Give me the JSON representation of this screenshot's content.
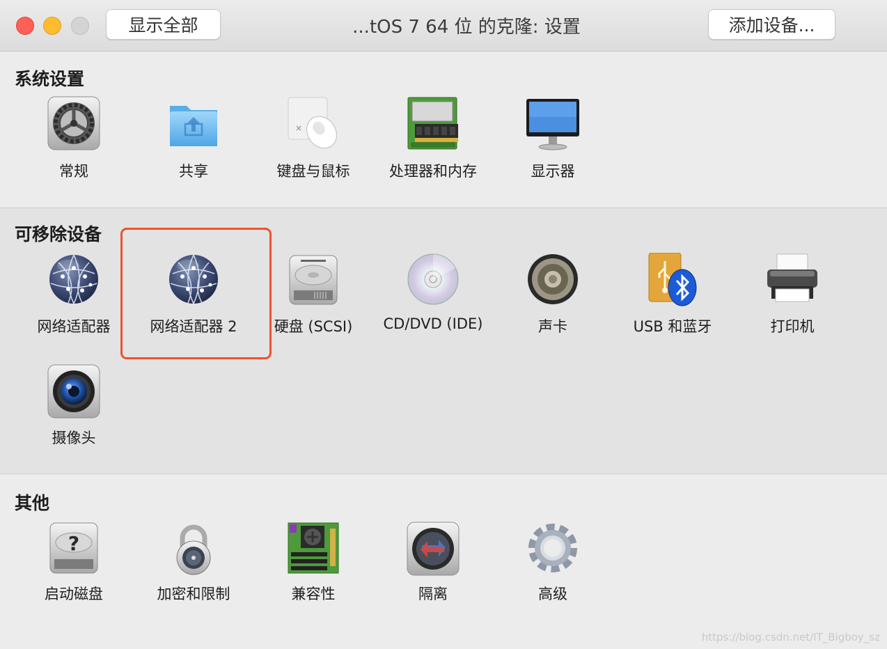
{
  "window": {
    "title": "...tOS 7 64 位 的克隆: 设置",
    "show_all_label": "显示全部",
    "add_device_label": "添加设备..."
  },
  "sections": {
    "system": {
      "title": "系统设置",
      "items": [
        {
          "label": "常规",
          "icon": "general-gear-icon"
        },
        {
          "label": "共享",
          "icon": "shared-folder-icon"
        },
        {
          "label": "键盘与鼠标",
          "icon": "keyboard-mouse-icon"
        },
        {
          "label": "处理器和内存",
          "icon": "processor-memory-icon"
        },
        {
          "label": "显示器",
          "icon": "display-icon"
        }
      ]
    },
    "removable": {
      "title": "可移除设备",
      "items": [
        {
          "label": "网络适配器",
          "icon": "network-globe-icon"
        },
        {
          "label": "网络适配器 2",
          "icon": "network-globe-icon"
        },
        {
          "label": "硬盘 (SCSI)",
          "icon": "hard-disk-icon"
        },
        {
          "label": "CD/DVD (IDE)",
          "icon": "cd-dvd-icon"
        },
        {
          "label": "声卡",
          "icon": "speaker-icon"
        },
        {
          "label": "USB 和蓝牙",
          "icon": "usb-bluetooth-icon"
        },
        {
          "label": "打印机",
          "icon": "printer-icon"
        },
        {
          "label": "摄像头",
          "icon": "camera-icon"
        }
      ]
    },
    "other": {
      "title": "其他",
      "items": [
        {
          "label": "启动磁盘",
          "icon": "startup-disk-icon"
        },
        {
          "label": "加密和限制",
          "icon": "lock-icon"
        },
        {
          "label": "兼容性",
          "icon": "motherboard-icon"
        },
        {
          "label": "隔离",
          "icon": "isolation-icon"
        },
        {
          "label": "高级",
          "icon": "advanced-gear-icon"
        }
      ]
    }
  },
  "watermark": "https://blog.csdn.net/IT_Bigboy_sz",
  "colors": {
    "highlight": "#ea5430",
    "close": "#fe5f57",
    "minimize": "#febc2e",
    "zoom_disabled": "#d3d3d3"
  }
}
